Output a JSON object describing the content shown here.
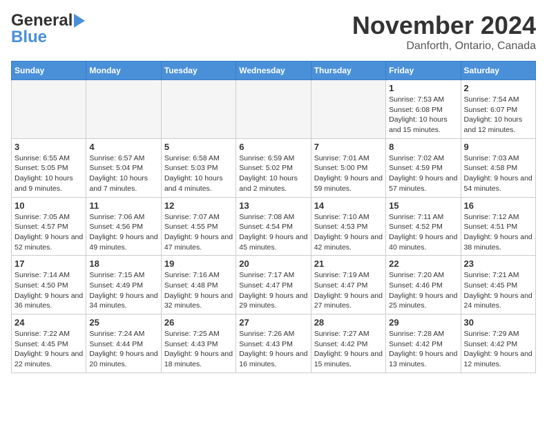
{
  "header": {
    "logo_line1": "General",
    "logo_line2": "Blue",
    "month_title": "November 2024",
    "location": "Danforth, Ontario, Canada"
  },
  "weekdays": [
    "Sunday",
    "Monday",
    "Tuesday",
    "Wednesday",
    "Thursday",
    "Friday",
    "Saturday"
  ],
  "weeks": [
    [
      {
        "day": "",
        "info": ""
      },
      {
        "day": "",
        "info": ""
      },
      {
        "day": "",
        "info": ""
      },
      {
        "day": "",
        "info": ""
      },
      {
        "day": "",
        "info": ""
      },
      {
        "day": "1",
        "info": "Sunrise: 7:53 AM\nSunset: 6:08 PM\nDaylight: 10 hours and 15 minutes."
      },
      {
        "day": "2",
        "info": "Sunrise: 7:54 AM\nSunset: 6:07 PM\nDaylight: 10 hours and 12 minutes."
      }
    ],
    [
      {
        "day": "3",
        "info": "Sunrise: 6:55 AM\nSunset: 5:05 PM\nDaylight: 10 hours and 9 minutes."
      },
      {
        "day": "4",
        "info": "Sunrise: 6:57 AM\nSunset: 5:04 PM\nDaylight: 10 hours and 7 minutes."
      },
      {
        "day": "5",
        "info": "Sunrise: 6:58 AM\nSunset: 5:03 PM\nDaylight: 10 hours and 4 minutes."
      },
      {
        "day": "6",
        "info": "Sunrise: 6:59 AM\nSunset: 5:02 PM\nDaylight: 10 hours and 2 minutes."
      },
      {
        "day": "7",
        "info": "Sunrise: 7:01 AM\nSunset: 5:00 PM\nDaylight: 9 hours and 59 minutes."
      },
      {
        "day": "8",
        "info": "Sunrise: 7:02 AM\nSunset: 4:59 PM\nDaylight: 9 hours and 57 minutes."
      },
      {
        "day": "9",
        "info": "Sunrise: 7:03 AM\nSunset: 4:58 PM\nDaylight: 9 hours and 54 minutes."
      }
    ],
    [
      {
        "day": "10",
        "info": "Sunrise: 7:05 AM\nSunset: 4:57 PM\nDaylight: 9 hours and 52 minutes."
      },
      {
        "day": "11",
        "info": "Sunrise: 7:06 AM\nSunset: 4:56 PM\nDaylight: 9 hours and 49 minutes."
      },
      {
        "day": "12",
        "info": "Sunrise: 7:07 AM\nSunset: 4:55 PM\nDaylight: 9 hours and 47 minutes."
      },
      {
        "day": "13",
        "info": "Sunrise: 7:08 AM\nSunset: 4:54 PM\nDaylight: 9 hours and 45 minutes."
      },
      {
        "day": "14",
        "info": "Sunrise: 7:10 AM\nSunset: 4:53 PM\nDaylight: 9 hours and 42 minutes."
      },
      {
        "day": "15",
        "info": "Sunrise: 7:11 AM\nSunset: 4:52 PM\nDaylight: 9 hours and 40 minutes."
      },
      {
        "day": "16",
        "info": "Sunrise: 7:12 AM\nSunset: 4:51 PM\nDaylight: 9 hours and 38 minutes."
      }
    ],
    [
      {
        "day": "17",
        "info": "Sunrise: 7:14 AM\nSunset: 4:50 PM\nDaylight: 9 hours and 36 minutes."
      },
      {
        "day": "18",
        "info": "Sunrise: 7:15 AM\nSunset: 4:49 PM\nDaylight: 9 hours and 34 minutes."
      },
      {
        "day": "19",
        "info": "Sunrise: 7:16 AM\nSunset: 4:48 PM\nDaylight: 9 hours and 32 minutes."
      },
      {
        "day": "20",
        "info": "Sunrise: 7:17 AM\nSunset: 4:47 PM\nDaylight: 9 hours and 29 minutes."
      },
      {
        "day": "21",
        "info": "Sunrise: 7:19 AM\nSunset: 4:47 PM\nDaylight: 9 hours and 27 minutes."
      },
      {
        "day": "22",
        "info": "Sunrise: 7:20 AM\nSunset: 4:46 PM\nDaylight: 9 hours and 25 minutes."
      },
      {
        "day": "23",
        "info": "Sunrise: 7:21 AM\nSunset: 4:45 PM\nDaylight: 9 hours and 24 minutes."
      }
    ],
    [
      {
        "day": "24",
        "info": "Sunrise: 7:22 AM\nSunset: 4:45 PM\nDaylight: 9 hours and 22 minutes."
      },
      {
        "day": "25",
        "info": "Sunrise: 7:24 AM\nSunset: 4:44 PM\nDaylight: 9 hours and 20 minutes."
      },
      {
        "day": "26",
        "info": "Sunrise: 7:25 AM\nSunset: 4:43 PM\nDaylight: 9 hours and 18 minutes."
      },
      {
        "day": "27",
        "info": "Sunrise: 7:26 AM\nSunset: 4:43 PM\nDaylight: 9 hours and 16 minutes."
      },
      {
        "day": "28",
        "info": "Sunrise: 7:27 AM\nSunset: 4:42 PM\nDaylight: 9 hours and 15 minutes."
      },
      {
        "day": "29",
        "info": "Sunrise: 7:28 AM\nSunset: 4:42 PM\nDaylight: 9 hours and 13 minutes."
      },
      {
        "day": "30",
        "info": "Sunrise: 7:29 AM\nSunset: 4:42 PM\nDaylight: 9 hours and 12 minutes."
      }
    ]
  ]
}
